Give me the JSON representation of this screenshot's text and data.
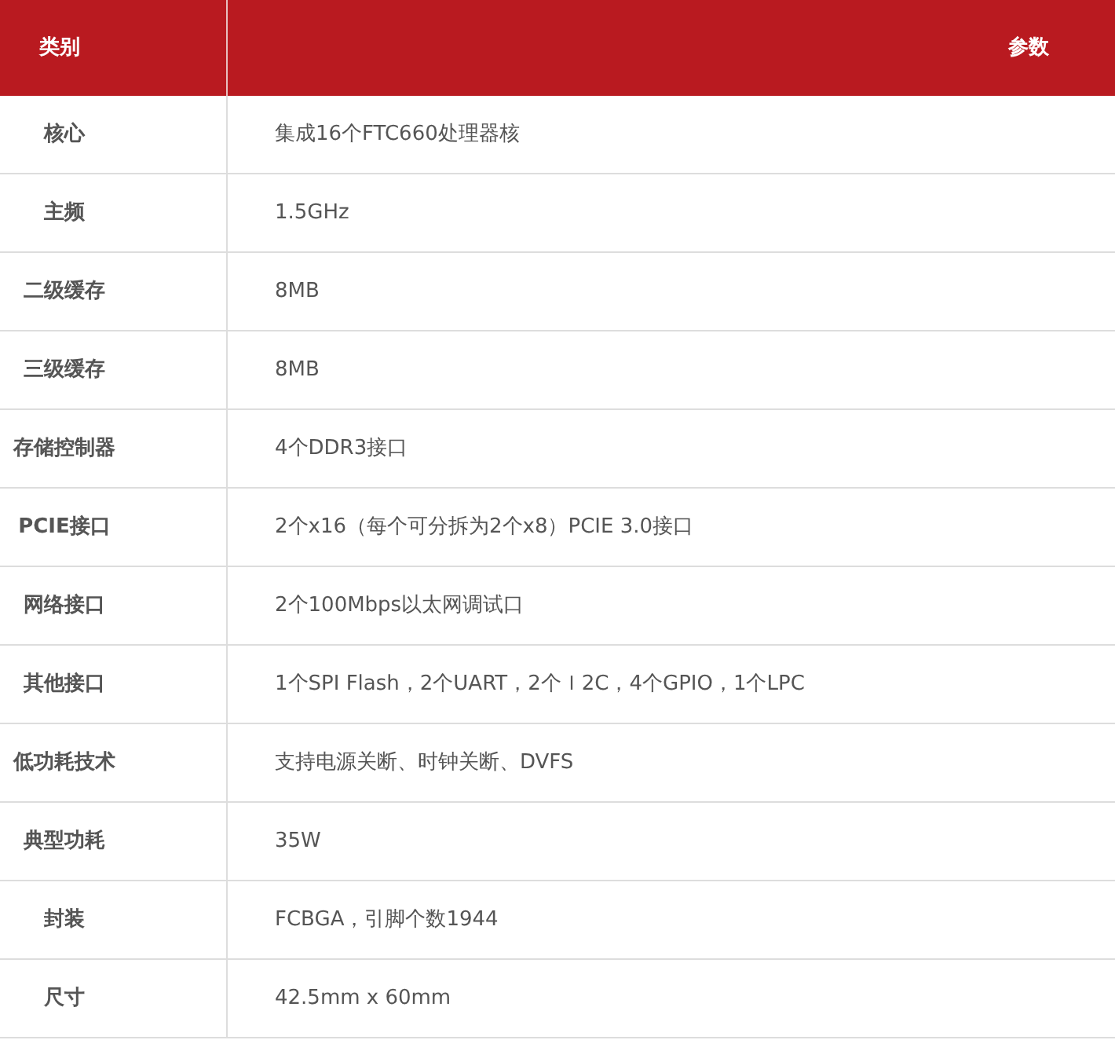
{
  "table": {
    "columns": [
      "类别",
      "参数"
    ],
    "rows": [
      {
        "category": "核心",
        "value": "集成16个FTC660处理器核"
      },
      {
        "category": "主频",
        "value": "1.5GHz"
      },
      {
        "category": "二级缓存",
        "value": "8MB"
      },
      {
        "category": "三级缓存",
        "value": "8MB"
      },
      {
        "category": "存储控制器",
        "value": "4个DDR3接口"
      },
      {
        "category": "PCIE接口",
        "value": "2个x16（每个可分拆为2个x8）PCIE 3.0接口"
      },
      {
        "category": "网络接口",
        "value": "2个100Mbps以太网调试口"
      },
      {
        "category": "其他接口",
        "value": "1个SPI Flash，2个UART，2个Ｉ2C，4个GPIO，1个LPC"
      },
      {
        "category": "低功耗技术",
        "value": "支持电源关断、时钟关断、DVFS"
      },
      {
        "category": "典型功耗",
        "value": "35W"
      },
      {
        "category": "封装",
        "value": "FCBGA，引脚个数1944"
      },
      {
        "category": "尺寸",
        "value": "42.5mm x 60mm"
      }
    ]
  }
}
